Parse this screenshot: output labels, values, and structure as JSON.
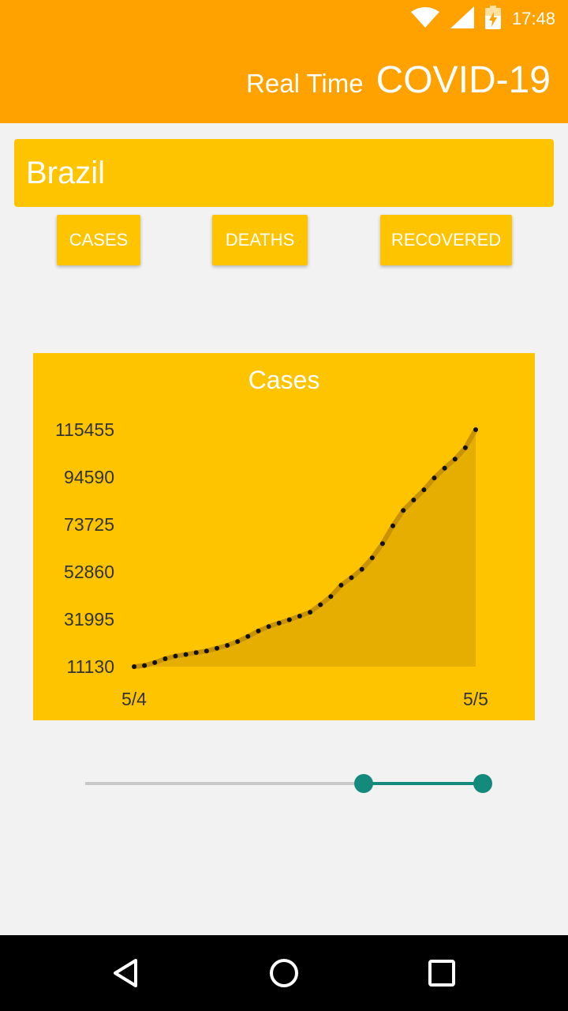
{
  "status_bar": {
    "time": "17:48",
    "icons": [
      "wifi-icon",
      "signal-icon",
      "battery-charging-icon"
    ]
  },
  "header": {
    "subtitle": "Real Time",
    "title": "COVID-19"
  },
  "country": {
    "name": "Brazil"
  },
  "tabs": [
    {
      "label": "CASES"
    },
    {
      "label": "DEATHS"
    },
    {
      "label": "RECOVERED"
    }
  ],
  "colors": {
    "app_bar": "#ffa200",
    "panel": "#ffc400",
    "area_fill": "#e5ae00",
    "line": "#c99300",
    "slider": "#138a7c"
  },
  "chart_data": {
    "type": "area",
    "title": "Cases",
    "xlabel": "",
    "ylabel": "",
    "x_tick_labels": [
      "5/4",
      "5/5"
    ],
    "y_tick_labels": [
      "115455",
      "94590",
      "73725",
      "52860",
      "31995",
      "11130"
    ],
    "ylim": [
      11130,
      115455
    ],
    "grid": false,
    "series": [
      {
        "values": [
          11130,
          11600,
          12900,
          14600,
          15800,
          16500,
          17300,
          18000,
          19200,
          20500,
          22200,
          24400,
          26800,
          28800,
          30300,
          31800,
          33400,
          35100,
          38400,
          42000,
          47000,
          50300,
          54000,
          59000,
          65300,
          73100,
          79900,
          84500,
          89000,
          94200,
          98500,
          102500,
          107500,
          115455
        ]
      }
    ]
  },
  "range_slider": {
    "low_fraction": 0.7,
    "high_fraction": 1.0
  },
  "nav": {
    "icons": [
      "back-icon",
      "home-icon",
      "recents-icon"
    ]
  }
}
